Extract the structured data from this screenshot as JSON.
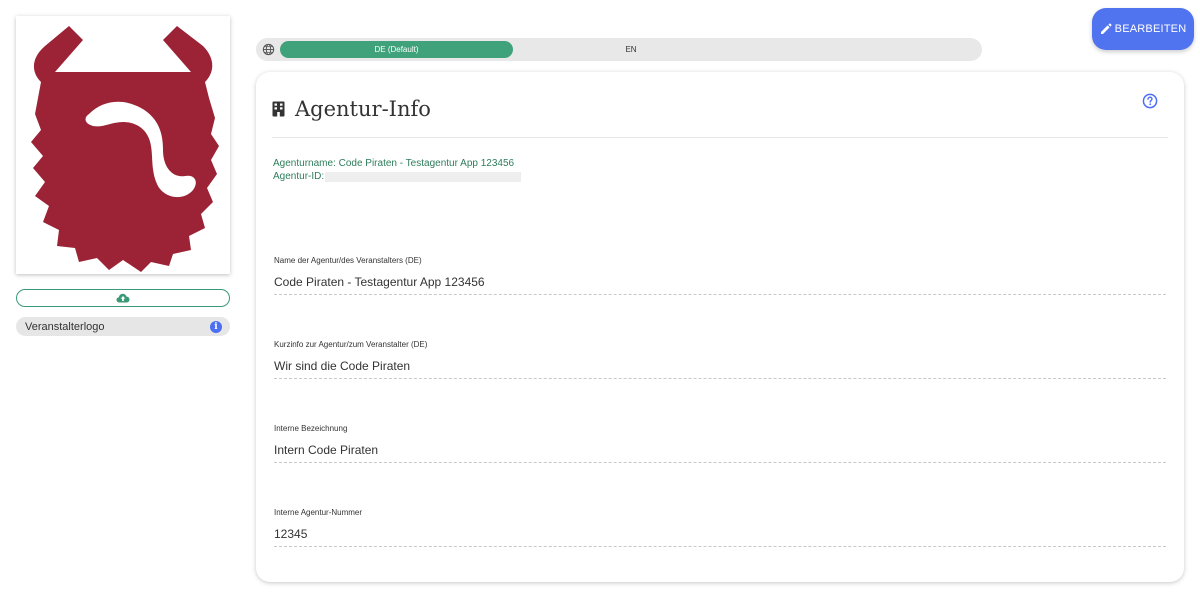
{
  "left_panel": {
    "logo_label": "Veranstalterlogo",
    "upload_icon": "cloud-upload-icon",
    "info_icon": "info-icon"
  },
  "language": {
    "icon": "globe-icon",
    "tabs": [
      {
        "label": "DE (Default)",
        "active": true
      },
      {
        "label": "EN",
        "active": false
      }
    ]
  },
  "toolbar": {
    "edit_label": "BEARBEITEN",
    "edit_icon": "pencil-icon"
  },
  "card": {
    "title": "Agentur-Info",
    "title_icon": "building-icon",
    "help_icon": "help-icon",
    "agency_name_line": "Agenturname: Code Piraten - Testagentur App 123456",
    "agency_id_label": "Agentur-ID:",
    "fields": [
      {
        "label": "Name der Agentur/des Veranstalters (DE)",
        "value": "Code Piraten - Testagentur App 123456"
      },
      {
        "label": "Kurzinfo zur Agentur/zum Veranstalter (DE)",
        "value": "Wir sind die Code Piraten"
      },
      {
        "label": "Interne Bezeichnung",
        "value": "Intern Code Piraten"
      },
      {
        "label": "Interne Agentur-Nummer",
        "value": "12345"
      }
    ]
  },
  "colors": {
    "accent_green": "#3fa27a",
    "button_blue": "#5074f0",
    "logo_red": "#9b2335"
  }
}
